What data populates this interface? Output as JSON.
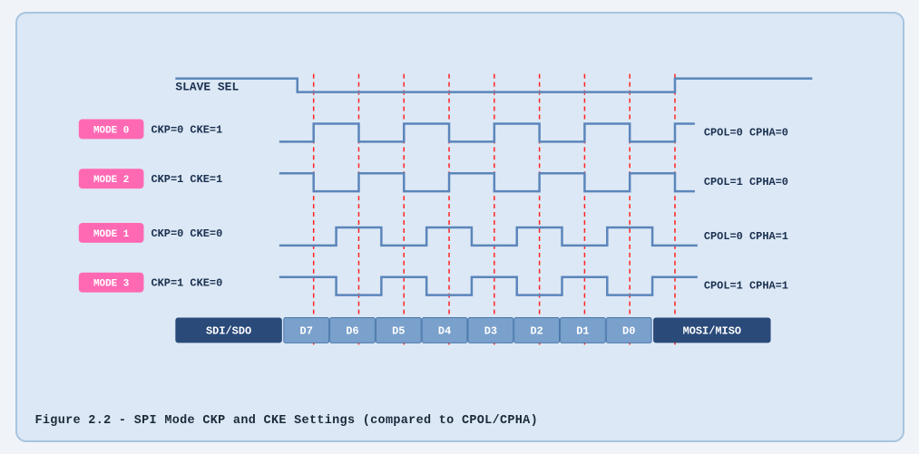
{
  "figure": {
    "caption": "Figure 2.2 - SPI Mode CKP and CKE Settings (compared to CPOL/CPHA)",
    "slave_sel_label": "SLAVE SEL",
    "modes": [
      {
        "id": "MODE 0",
        "params": "CKP=0  CKE=1",
        "cpol_cpha": "CPOL=0  CPHA=0"
      },
      {
        "id": "MODE 2",
        "params": "CKP=1  CKE=1",
        "cpol_cpha": "CPOL=1  CPHA=0"
      },
      {
        "id": "MODE 1",
        "params": "CKP=0  CKE=0",
        "cpol_cpha": "CPOL=0  CPHA=1"
      },
      {
        "id": "MODE 3",
        "params": "CKP=1  CKE=0",
        "cpol_cpha": "CPOL=1  CPHA=1"
      }
    ],
    "data_labels": [
      "SDI/SDO",
      "D7",
      "D6",
      "D5",
      "D4",
      "D3",
      "D2",
      "D1",
      "D0",
      "MOSI/MISO"
    ],
    "colors": {
      "background": "#dce8f5",
      "border": "#a8c4e0",
      "waveform": "#5b85bb",
      "dashed": "#ff0000",
      "mode_badge": "#ff69b4",
      "data_bar": "#2a4a7a",
      "data_cell": "#7aa0cc"
    }
  }
}
